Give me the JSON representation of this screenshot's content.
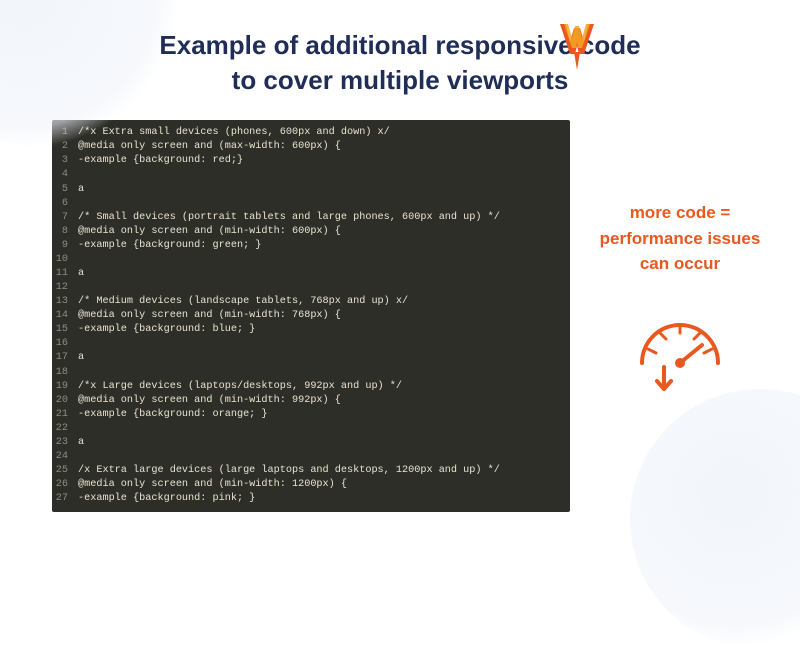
{
  "title_line1": "Example of additional responsive code",
  "title_line2": "to cover multiple viewports",
  "logo_name": "w-rocket-logo",
  "code_lines": [
    "/*x Extra small devices (phones, 600px and down) x/",
    "@media only screen and (max-width: 600px) {",
    "-example {background: red;}",
    "",
    "a",
    "",
    "/* Small devices (portrait tablets and large phones, 600px and up) */",
    "@media only screen and (min-width: 600px) {",
    "-example {background: green; }",
    "",
    "a",
    "",
    "/* Medium devices (landscape tablets, 768px and up) x/",
    "@media only screen and (min-width: 768px) {",
    "-example {background: blue; }",
    "",
    "a",
    "",
    "/*x Large devices (laptops/desktops, 992px and up) */",
    "@media only screen and (min-width: 992px) {",
    "-example {background: orange; }",
    "",
    "a",
    "",
    "/x Extra large devices (large laptops and desktops, 1200px and up) */",
    "@media only screen and (min-width: 1200px) {",
    "-example {background: pink; }"
  ],
  "side_line1": "more code =",
  "side_line2": "performance issues",
  "side_line3": "can occur",
  "colors": {
    "title": "#1f2d57",
    "accent": "#e8581f",
    "code_bg": "#2e2e29",
    "code_fg": "#e8e3ce",
    "lineno": "#8f8d80"
  }
}
